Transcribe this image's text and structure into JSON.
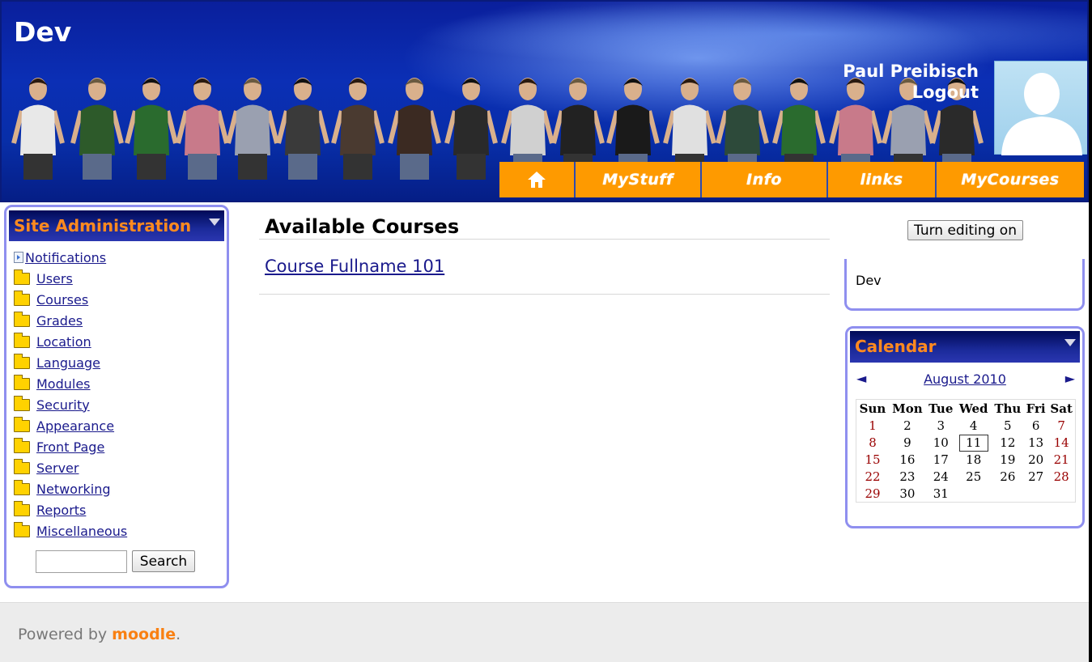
{
  "site": {
    "title": "Dev"
  },
  "user": {
    "name": "Paul Preibisch",
    "logout_label": "Logout"
  },
  "nav": {
    "items": [
      {
        "label": "",
        "icon": "home-icon"
      },
      {
        "label": "MyStuff"
      },
      {
        "label": "Info"
      },
      {
        "label": "links"
      },
      {
        "label": "MyCourses"
      }
    ]
  },
  "admin": {
    "title": "Site Administration",
    "items": [
      {
        "label": "Notifications",
        "icon": "page-icon"
      },
      {
        "label": "Users",
        "icon": "folder-icon"
      },
      {
        "label": "Courses",
        "icon": "folder-icon"
      },
      {
        "label": "Grades",
        "icon": "folder-icon"
      },
      {
        "label": "Location",
        "icon": "folder-icon"
      },
      {
        "label": "Language",
        "icon": "folder-icon"
      },
      {
        "label": "Modules",
        "icon": "folder-icon"
      },
      {
        "label": "Security",
        "icon": "folder-icon"
      },
      {
        "label": "Appearance",
        "icon": "folder-icon"
      },
      {
        "label": "Front Page",
        "icon": "folder-icon"
      },
      {
        "label": "Server",
        "icon": "folder-icon"
      },
      {
        "label": "Networking",
        "icon": "folder-icon"
      },
      {
        "label": "Reports",
        "icon": "folder-icon"
      },
      {
        "label": "Miscellaneous",
        "icon": "folder-icon"
      }
    ],
    "search_value": "",
    "search_button": "Search"
  },
  "main": {
    "heading": "Available Courses",
    "courses": [
      "Course Fullname 101"
    ]
  },
  "editing_button": "Turn editing on",
  "dev_block": {
    "text": "Dev"
  },
  "calendar": {
    "title": "Calendar",
    "prev": "◄",
    "next": "►",
    "month": "August 2010",
    "weekdays": [
      "Sun",
      "Mon",
      "Tue",
      "Wed",
      "Thu",
      "Fri",
      "Sat"
    ],
    "weeks": [
      [
        "1",
        "2",
        "3",
        "4",
        "5",
        "6",
        "7"
      ],
      [
        "8",
        "9",
        "10",
        "11",
        "12",
        "13",
        "14"
      ],
      [
        "15",
        "16",
        "17",
        "18",
        "19",
        "20",
        "21"
      ],
      [
        "22",
        "23",
        "24",
        "25",
        "26",
        "27",
        "28"
      ],
      [
        "29",
        "30",
        "31",
        "",
        "",
        "",
        ""
      ]
    ],
    "today": "11"
  },
  "footer": {
    "powered_by": "Powered by",
    "logo_text": "moodle",
    "logo_suffix": "."
  },
  "colors": {
    "header_blue": "#0b2fb5",
    "nav_orange": "#fe9a00",
    "block_title": "#ff8a1f",
    "link": "#1a1a8c",
    "weekend": "#990000"
  }
}
